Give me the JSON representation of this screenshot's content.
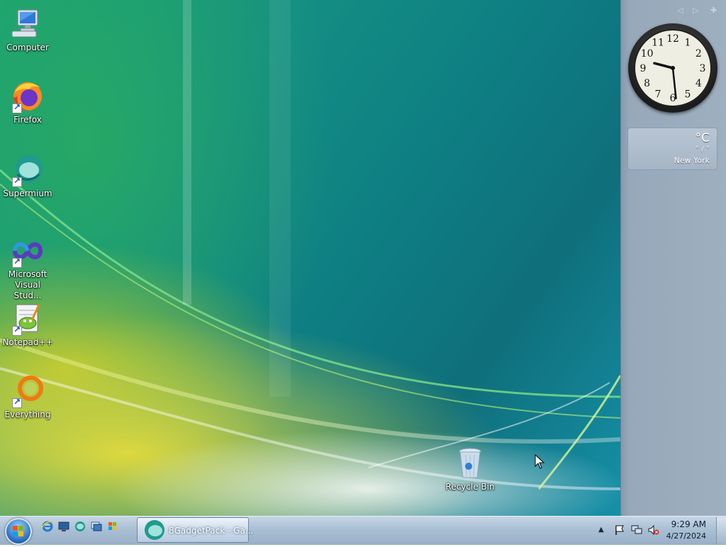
{
  "desktop": {
    "icons": [
      {
        "label": "Computer",
        "icon": "computer-icon",
        "shortcut": false
      },
      {
        "label": "Firefox",
        "icon": "firefox-icon",
        "shortcut": true
      },
      {
        "label": "Supermium",
        "icon": "supermium-icon",
        "shortcut": true
      },
      {
        "label": "Microsoft Visual Stud...",
        "label_line1": "Microsoft",
        "label_line2": "Visual Stud...",
        "icon": "visual-studio-icon",
        "shortcut": true
      },
      {
        "label": "Notepad++",
        "icon": "notepadpp-icon",
        "shortcut": true
      },
      {
        "label": "Everything",
        "icon": "everything-icon",
        "shortcut": true
      }
    ],
    "recycle_bin": {
      "label": "Recycle Bin",
      "icon": "recycle-bin-icon"
    }
  },
  "sidebar": {
    "controls": [
      "prev-icon",
      "next-icon",
      "add-gadget-icon"
    ],
    "clock": {
      "numerals": [
        "12",
        "1",
        "2",
        "3",
        "4",
        "5",
        "6",
        "7",
        "8",
        "9",
        "10",
        "11"
      ],
      "hour": 9,
      "minute": 29
    },
    "weather": {
      "temperature": "°C",
      "range": "° / °",
      "city": "New York"
    }
  },
  "taskbar": {
    "start_icon": "windows-logo-icon",
    "quick_launch": [
      "internet-explorer-icon",
      "show-desktop-icon",
      "supermium-icon",
      "switch-windows-icon",
      "windows-flag-icon"
    ],
    "task_button": {
      "label": "8GadgetPack - Ga...",
      "icon": "supermium-icon"
    },
    "tray": [
      "show-hidden-icon",
      "action-center-flag-icon",
      "network-icon",
      "volume-muted-icon"
    ],
    "time": "9:29 AM",
    "date": "4/27/2024"
  },
  "colors": {
    "accent": "#2b6fc0",
    "sidebar": "#9eafc0",
    "taskbar": "#a9bfd4"
  }
}
